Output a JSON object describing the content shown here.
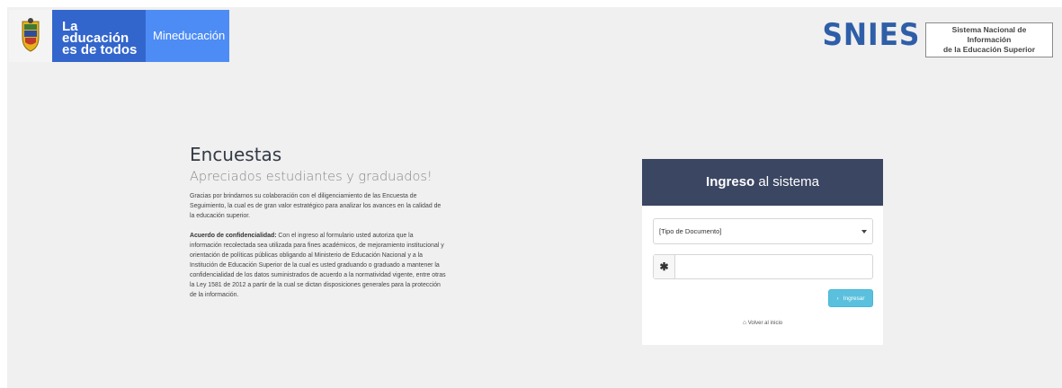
{
  "header": {
    "slogan_line1": "La educación",
    "slogan_line2": "es de todos",
    "ministry": "Mineducación",
    "brand": "SNIES",
    "brand_sub_line1": "Sistema Nacional de Información",
    "brand_sub_line2": "de la Educación Superior"
  },
  "intro": {
    "title": "Encuestas",
    "subtitle": "Apreciados estudiantes y graduados!",
    "paragraph1": "Gracias por brindarnos su colaboración con el diligenciamiento de las Encuesta de Seguimiento, la cual es de gran valor estratégico para analizar los avances en la calidad de la educación superior.",
    "agreement_label": "Acuerdo de confidencialidad:",
    "agreement_text": " Con el ingreso al formulario usted autoriza que la información recolectada sea utilizada para fines académicos, de mejoramiento institucional y orientación de políticas públicas obligando al Ministerio de Educación Nacional y a la Institución de Educación Superior de la cual es usted graduando o graduado a mantener la confidencialidad de los datos suministrados de acuerdo a la normatividad vigente, entre otras la Ley 1581 de 2012 a partir de la cual se dictan disposiciones generales para la protección de la información."
  },
  "login": {
    "title_bold": "Ingreso",
    "title_rest": " al sistema",
    "doc_type_selected": "[Tipo de Documento]",
    "doc_number_value": "",
    "required_marker": "✱",
    "submit_label": "Ingresar",
    "submit_icon": "›",
    "back_label": "Volver al inicio",
    "back_icon": "⌂"
  },
  "colors": {
    "accent_dark": "#3a4662",
    "button": "#5bc0de",
    "brand": "#2f5ea8",
    "gov_blue": "#3366cc",
    "gov_light_blue": "#4d8cf5"
  }
}
